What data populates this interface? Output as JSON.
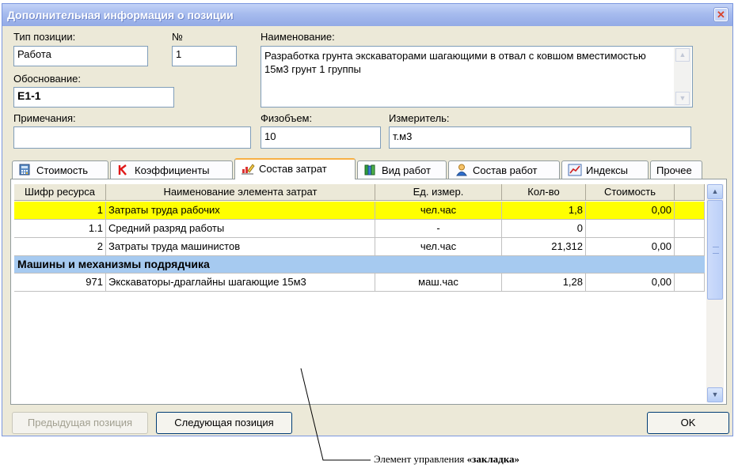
{
  "window": {
    "title": "Дополнительная информация о позиции",
    "close_glyph": "✕"
  },
  "fields": {
    "type_label": "Тип позиции:",
    "type_value": "Работа",
    "number_label": "№",
    "number_value": "1",
    "name_label": "Наименование:",
    "name_value": "Разработка грунта экскаваторами шагающими в отвал с ковшом вместимостью 15м3 грунт 1 группы",
    "basis_label": "Обоснование:",
    "basis_value": "Е1-1",
    "notes_label": "Примечания:",
    "notes_value": "",
    "volume_label": "Физобъем:",
    "volume_value": "10",
    "unit_label": "Измеритель:",
    "unit_value": "т.м3"
  },
  "tabs": [
    {
      "label": "Стоимость",
      "icon": "calculator-icon"
    },
    {
      "label": "Коэффициенты",
      "icon": "coefficient-k-icon"
    },
    {
      "label": "Состав затрат",
      "icon": "pencil-chart-icon",
      "active": true
    },
    {
      "label": "Вид работ",
      "icon": "books-icon"
    },
    {
      "label": "Состав работ",
      "icon": "person-icon"
    },
    {
      "label": "Индексы",
      "icon": "line-chart-icon"
    },
    {
      "label": "Прочее"
    }
  ],
  "grid": {
    "columns": [
      "Шифр ресурса",
      "Наименование элемента затрат",
      "Ед. измер.",
      "Кол-во",
      "Стоимость"
    ],
    "rows": [
      {
        "code": "1",
        "name": "Затраты труда рабочих",
        "unit": "чел.час",
        "qty": "1,8",
        "cost": "0,00",
        "highlight_color": "#ffff00"
      },
      {
        "code": "1.1",
        "name": "Средний разряд работы",
        "unit": "-",
        "qty": "0",
        "cost": ""
      },
      {
        "code": "2",
        "name": "Затраты труда машинистов",
        "unit": "чел.час",
        "qty": "21,312",
        "cost": "0,00"
      },
      {
        "group": "Машины и механизмы подрядчика",
        "group_color": "#a6caf0"
      },
      {
        "code": "971",
        "name": "Экскаваторы-драглайны шагающие 15м3",
        "unit": "маш.час",
        "qty": "1,28",
        "cost": "0,00"
      }
    ]
  },
  "buttons": {
    "prev": "Предыдущая позиция",
    "next": "Следующая позиция",
    "ok": "OK"
  },
  "annotation": {
    "text_plain": "Элемент управления ",
    "text_bold": "«закладка»"
  }
}
